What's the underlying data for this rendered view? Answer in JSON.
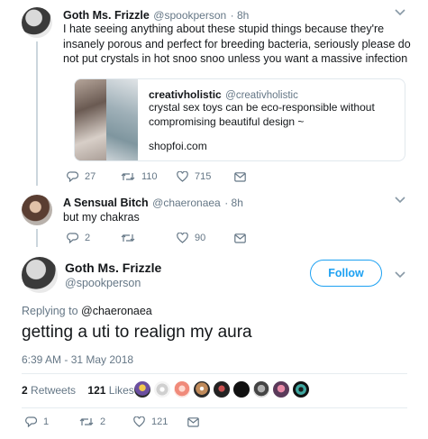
{
  "tweet1": {
    "name": "Goth Ms. Frizzle",
    "handle": "@spookperson",
    "time": "· 8h",
    "text": "I hate seeing anything about these stupid things because they're insanely porous and perfect for breeding bacteria, seriously please do not put crystals in hot snoo snoo unless you want a massive infection",
    "card": {
      "name": "creativholistic",
      "handle": "@creativholistic",
      "text": "crystal sex toys can be eco-responsible without compromising beautiful design ~",
      "link": "shopfoi.com"
    },
    "replies": "27",
    "retweets": "110",
    "likes": "715"
  },
  "tweet2": {
    "name": "A Sensual Bitch",
    "handle": "@chaeronaea",
    "time": "· 8h",
    "text": "but my chakras",
    "replies": "2",
    "retweets": "",
    "likes": "90"
  },
  "main": {
    "name": "Goth Ms. Frizzle",
    "handle": "@spookperson",
    "follow_label": "Follow",
    "replying_prefix": "Replying to",
    "replying_to": "@chaeronaea",
    "text": "getting a uti to realign my aura",
    "timestamp": "6:39 AM - 31 May 2018",
    "retweets_count": "2",
    "retweets_label": "Retweets",
    "likes_count": "121",
    "likes_label": "Likes",
    "replies": "1",
    "retweets": "2",
    "likes": "121"
  },
  "colors": {
    "accent": "#1da1f2",
    "text": "#14171a",
    "muted": "#657786",
    "border": "#e1e8ed"
  },
  "icons": [
    "chevron-down-icon",
    "reply-icon",
    "retweet-icon",
    "like-icon",
    "message-icon"
  ]
}
